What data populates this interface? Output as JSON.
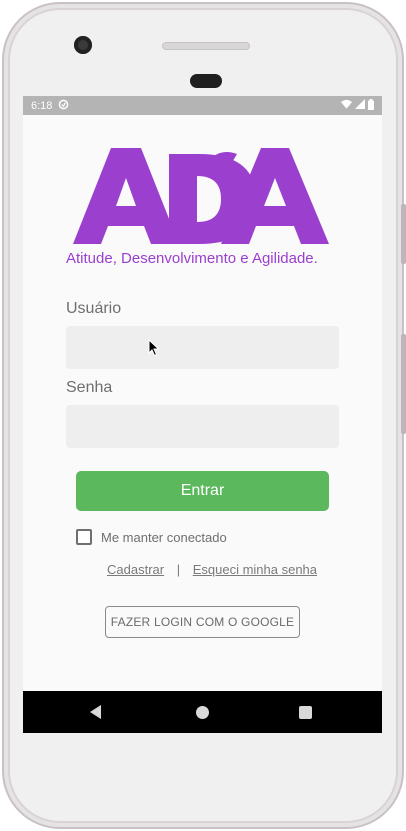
{
  "status_bar": {
    "time": "6:18"
  },
  "logo": {
    "text": "ADA",
    "color": "#9b3fcf"
  },
  "tagline": "Atitude, Desenvolvimento e Agilidade.",
  "form": {
    "username_label": "Usuário",
    "username_value": "",
    "password_label": "Senha",
    "password_value": "",
    "submit_label": "Entrar",
    "remember_label": "Me manter conectado",
    "remember_checked": false
  },
  "links": {
    "register": "Cadastrar",
    "separator": "|",
    "forgot_password": "Esqueci minha senha"
  },
  "google_button": "FAZER LOGIN COM O GOOGLE",
  "colors": {
    "primary_button": "#5cb85c",
    "brand_purple": "#9b3fcf",
    "status_bar": "#b4b4b4",
    "nav_bar": "#000000"
  }
}
